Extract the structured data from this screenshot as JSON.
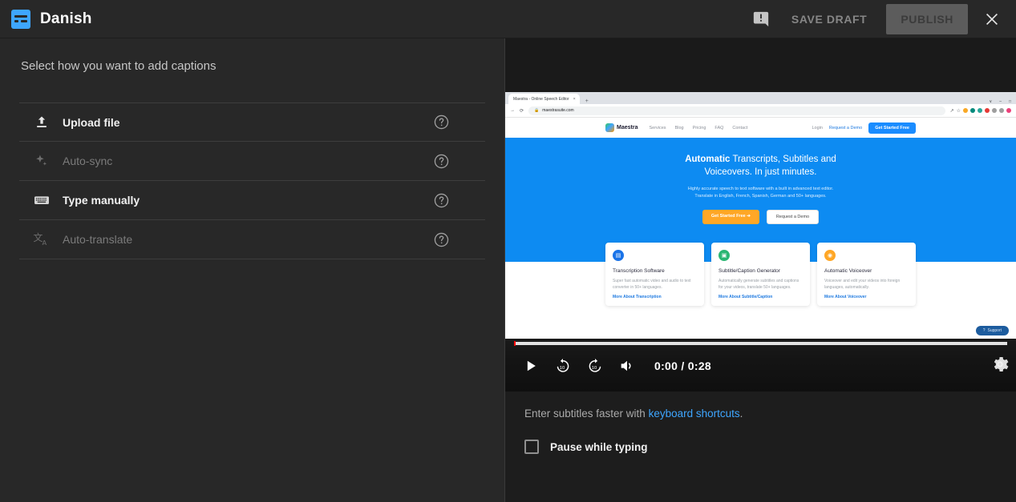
{
  "header": {
    "title": "Danish",
    "cc_icon": "closed-captions-icon",
    "feedback_icon": "feedback-icon",
    "save_draft_label": "SAVE DRAFT",
    "publish_label": "PUBLISH",
    "close_icon": "close-icon",
    "accent_color": "#3ea6ff",
    "publish_bg": "#5c5c5c"
  },
  "left_panel": {
    "heading": "Select how you want to add captions",
    "options": [
      {
        "label": "Upload file",
        "icon": "upload-icon",
        "disabled": false,
        "help_icon": "help-circle-icon"
      },
      {
        "label": "Auto-sync",
        "icon": "sparkle-icon",
        "disabled": true,
        "help_icon": "help-circle-icon"
      },
      {
        "label": "Type manually",
        "icon": "keyboard-icon",
        "disabled": false,
        "help_icon": "help-circle-icon"
      },
      {
        "label": "Auto-translate",
        "icon": "translate-icon",
        "disabled": true,
        "help_icon": "help-circle-icon"
      }
    ]
  },
  "player": {
    "play_icon": "play-icon",
    "rewind_label": "10",
    "forward_label": "10",
    "volume_icon": "volume-icon",
    "current_time": "0:00",
    "duration": "0:28",
    "time_display": "0:00 / 0:28",
    "settings_icon": "gear-icon",
    "progress_percent": 0,
    "playhead_color": "#ff0000"
  },
  "video_content": {
    "browser": {
      "tab_title": "Maestra - Online Speech Editor",
      "tab_close": "×",
      "new_tab": "+",
      "back_icon": "back-icon",
      "reload_icon": "reload-icon",
      "lock_icon": "lock-icon",
      "url": "maestrasuite.com",
      "share_icon": "share-icon",
      "bookmark_icon": "star-icon",
      "window_controls": [
        "∨",
        "–",
        "□"
      ],
      "extension_colors": [
        "#f9a825",
        "#00897b",
        "#26a69a",
        "#e53935",
        "#9e9e9e",
        "#9e9e9e",
        "#ec407a"
      ]
    },
    "site_nav": {
      "brand": "Maestra",
      "links": [
        "Services",
        "Blog",
        "Pricing",
        "FAQ",
        "Contact"
      ],
      "login": "Login",
      "demo": "Request a Demo",
      "cta": "Get Started Free"
    },
    "hero": {
      "title_bold": "Automatic",
      "title_rest": " Transcripts, Subtitles and",
      "title_line2": "Voiceovers. In just minutes.",
      "sub_line1": "Highly accurate speech to text software with a built in advanced text editor.",
      "sub_line2": "Translate in English, French, Spanish, German and 50+ languages.",
      "cta_primary": "Get Started Free ➔",
      "cta_secondary": "Request a Demo",
      "bg_color": "#0d8bf2"
    },
    "cards": [
      {
        "icon": "document-icon",
        "icon_color": "#1a73e8",
        "title": "Transcription Software",
        "body": "Super fast automatic video and audio to text converter in 50+ languages.",
        "link": "More About Transcription"
      },
      {
        "icon": "caption-icon",
        "icon_color": "#2bb673",
        "title": "Subtitle/Caption Generator",
        "body": "Automatically generate subtitles and captions for your videos, translate 50+ languages.",
        "link": "More About Subtitle/Caption"
      },
      {
        "icon": "voice-icon",
        "icon_color": "#ffa726",
        "title": "Automatic Voiceover",
        "body": "Voiceover and edit your videos into foreign languages, automatically.",
        "link": "More About Voiceover"
      }
    ],
    "support_pill": "Support"
  },
  "below_player": {
    "hint_prefix": "Enter subtitles faster with ",
    "hint_link": "keyboard shortcuts",
    "hint_suffix": ".",
    "pause_checkbox_label": "Pause while typing",
    "pause_checked": false
  }
}
